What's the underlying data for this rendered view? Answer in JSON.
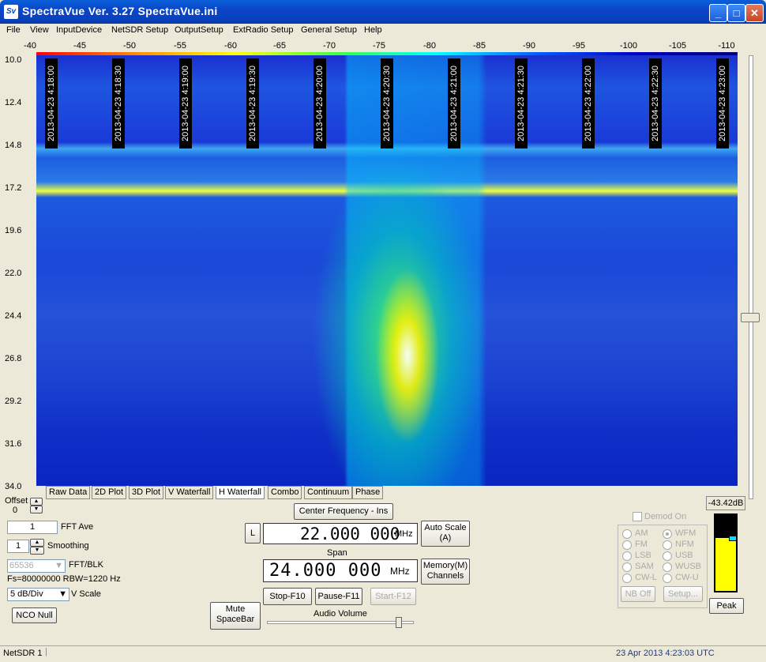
{
  "window": {
    "title": "SpectraVue Ver. 3.27  SpectraVue.ini",
    "icon": "Sv"
  },
  "menu": [
    "File",
    "View",
    "InputDevice",
    "NetSDR Setup",
    "OutputSetup",
    "ExtRadio Setup",
    "General Setup",
    "Help"
  ],
  "freq_scale": [
    "-40",
    "-45",
    "-50",
    "-55",
    "-60",
    "-65",
    "-70",
    "-75",
    "-80",
    "-85",
    "-90",
    "-95",
    "-100",
    "-105",
    "-110"
  ],
  "timestamps": [
    "2013-04-23 4:18:00",
    "2013-04-23 4:18:30",
    "2013-04-23 4:19:00",
    "2013-04-23 4:19:30",
    "2013-04-23 4:20:00",
    "2013-04-23 4:20:30",
    "2013-04-23 4:21:00",
    "2013-04-23 4:21:30",
    "2013-04-23 4:22:00",
    "2013-04-23 4:22:30",
    "2013-04-23 4:23:00"
  ],
  "y_labels": [
    "10.0",
    "12.4",
    "14.8",
    "17.2",
    "19.6",
    "22.0",
    "24.4",
    "26.8",
    "29.2",
    "31.6",
    "34.0"
  ],
  "tabs": [
    "Raw Data",
    "2D Plot",
    "3D Plot",
    "V Waterfall",
    "H Waterfall",
    "Combo",
    "Continuum",
    "Phase"
  ],
  "active_tab": "H Waterfall",
  "controls": {
    "offset_label": "Offset",
    "offset_value": "0",
    "fft_ave_value": "1",
    "fft_ave_label": "FFT Ave",
    "smoothing_value": "1",
    "smoothing_label": "Smoothing",
    "fft_blk_value": "65536",
    "fft_blk_label": "FFT/BLK",
    "fs_text": "Fs=80000000 RBW=1220 Hz",
    "vscale_value": "5 dB/Div",
    "vscale_label": "V Scale",
    "nco_null": "NCO Null",
    "mute_line1": "Mute",
    "mute_line2": "SpaceBar",
    "center_freq_button": "Center Frequency - Ins",
    "l_button": "L",
    "center_freq_value": "22.000 000",
    "center_freq_unit": "MHz",
    "auto_scale_line1": "Auto Scale",
    "auto_scale_line2": "(A)",
    "span_label": "Span",
    "span_value": "24.000 000",
    "span_unit": "MHz",
    "memory_line1": "Memory(M)",
    "memory_line2": "Channels",
    "stop": "Stop-F10",
    "pause": "Pause-F11",
    "start": "Start-F12",
    "audio_volume_label": "Audio Volume",
    "audio_volume_level": 0.9,
    "demod_on": "Demod On",
    "modes_left": [
      "AM",
      "FM",
      "LSB",
      "SAM",
      "CW-L"
    ],
    "modes_right": [
      "WFM",
      "NFM",
      "USB",
      "WUSB",
      "CW-U"
    ],
    "selected_mode": "WFM",
    "nb_off": "NB Off",
    "setup": "Setup...",
    "level_readout": "-43.42dB",
    "peak": "Peak",
    "meter_level": 0.7
  },
  "status": {
    "device": "NetSDR 1",
    "datetime": "23 Apr 2013  4:23:03 UTC"
  }
}
